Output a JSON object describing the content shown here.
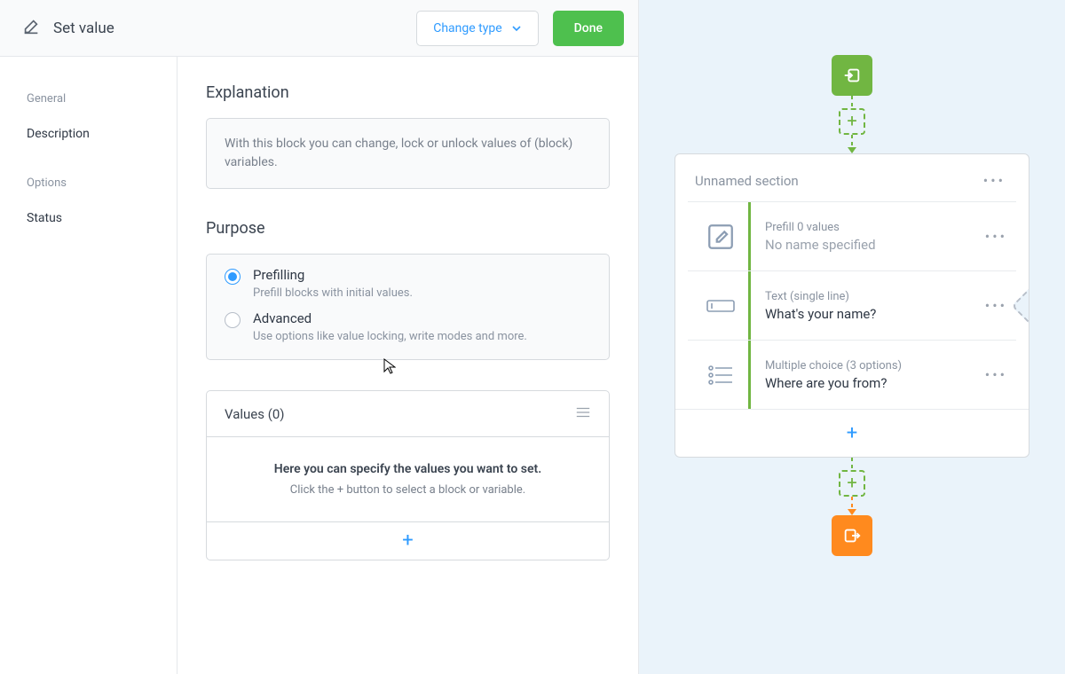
{
  "header": {
    "title": "Set value",
    "change_type": "Change type",
    "done": "Done"
  },
  "sidebar": {
    "groups": [
      {
        "label": "General",
        "items": [
          {
            "label": "Description"
          }
        ]
      },
      {
        "label": "Options",
        "items": [
          {
            "label": "Status"
          }
        ]
      }
    ]
  },
  "explanation": {
    "heading": "Explanation",
    "text": "With this block you can change, lock or unlock values of (block) variables."
  },
  "purpose": {
    "heading": "Purpose",
    "options": [
      {
        "title": "Prefilling",
        "subtitle": "Prefill blocks with initial values.",
        "selected": true
      },
      {
        "title": "Advanced",
        "subtitle": "Use options like value locking, write modes and more.",
        "selected": false
      }
    ]
  },
  "values": {
    "heading": "Values (0)",
    "empty_lead": "Here you can specify the values you want to set.",
    "empty_sub": "Click the + button to select a block or variable.",
    "add_symbol": "+"
  },
  "flow": {
    "section_title": "Unnamed section",
    "rows": [
      {
        "meta": "Prefill 0 values",
        "title": "No name specified",
        "muted": true,
        "icon": "edit"
      },
      {
        "meta": "Text (single line)",
        "title": "What's your name?",
        "muted": false,
        "icon": "text"
      },
      {
        "meta": "Multiple choice (3 options)",
        "title": "Where are you from?",
        "muted": false,
        "icon": "list"
      }
    ],
    "add_symbol": "+"
  },
  "icons": {
    "plus": "+",
    "dots": "•••"
  }
}
